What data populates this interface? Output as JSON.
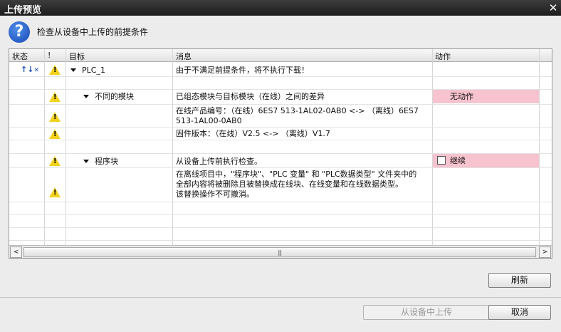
{
  "window": {
    "title": "上传预览",
    "close_glyph": "✕"
  },
  "header": {
    "message": "检查从设备中上传的前提条件"
  },
  "columns": {
    "status": "状态",
    "warn": "!",
    "target": "目标",
    "message": "消息",
    "action": "动作"
  },
  "rows": {
    "r0": {
      "target": "PLC_1",
      "message": "由于不满足前提条件，将不执行下载！"
    },
    "r1": {
      "target": "不同的模块",
      "message": "已组态模块与目标模块（在线）之间的差异",
      "action": "无动作"
    },
    "r2": {
      "message_line1": "在线产品编号：（在线）6ES7 513-1AL02-0AB0 <-> （离线）6ES7",
      "message_line2": "513-1AL00-0AB0"
    },
    "r3": {
      "message": "固件版本：（在线）V2.5 <-> （离线）V1.7"
    },
    "r4": {
      "target": "程序块",
      "message": "从设备上传前执行检查。",
      "action": "继续"
    },
    "r5": {
      "message_line1": "在离线项目中，\"程序块\"、\"PLC 变量\" 和 \"PLC数据类型\" 文件夹中的",
      "message_line2": "全部内容将被删除且被替换成在线块、在线变量和在线数据类型。",
      "message_line3": "该替换操作不可撤消。"
    }
  },
  "scrollbar": {
    "left": "<",
    "right": ">",
    "grip": "|||"
  },
  "buttons": {
    "refresh": "刷新",
    "upload": "从设备中上传",
    "cancel": "取消"
  },
  "colors": {
    "pink": "#f7c3cf",
    "warning": "#f2d21c",
    "accent": "#1747b8"
  }
}
